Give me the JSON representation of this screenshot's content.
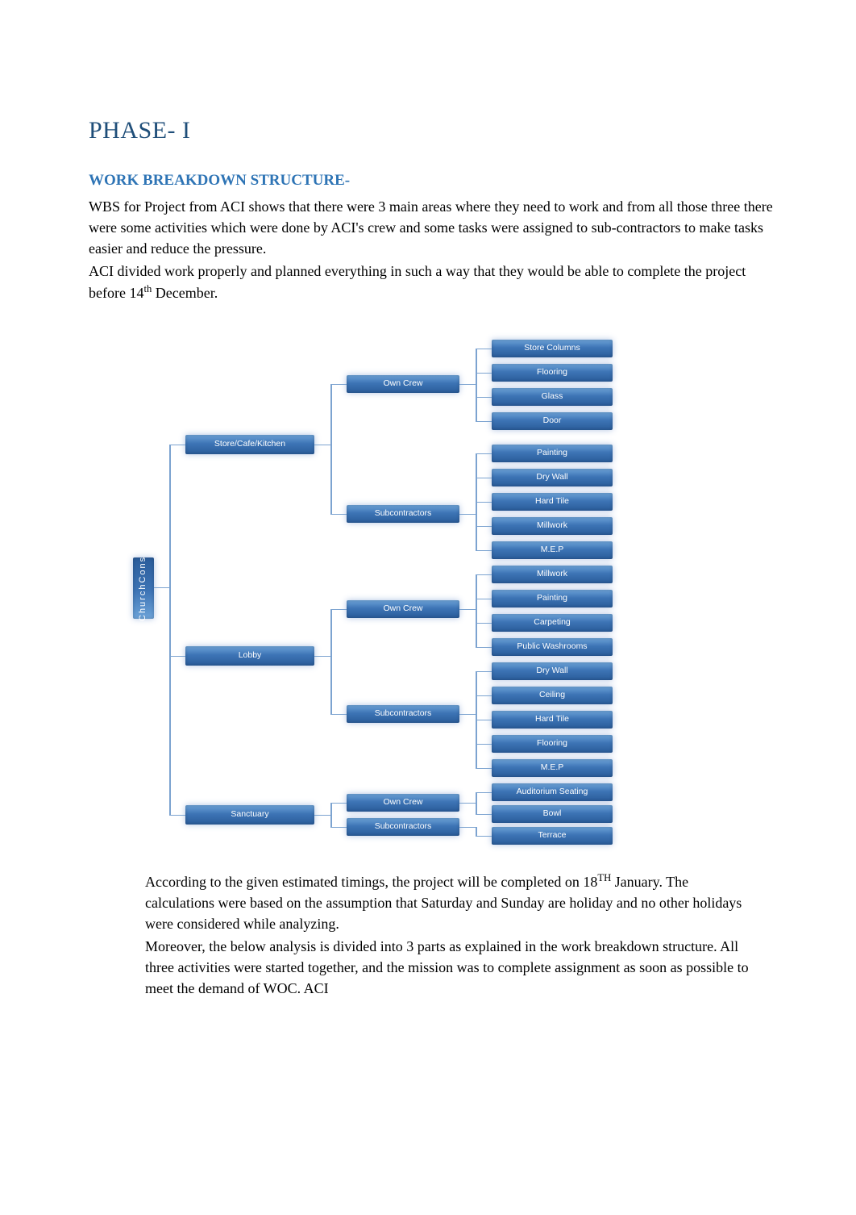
{
  "title": "PHASE- I",
  "subtitle": "WORK BREAKDOWN STRUCTURE-",
  "intro": {
    "p1": "WBS for Project from ACI shows that there were 3 main areas where they need to work and from all those three there were some activities which were done by ACI's crew and some tasks were assigned to sub-contractors to make tasks easier and reduce the pressure.",
    "p2a": "ACI divided work properly and planned everything in such a way that they would be able to complete the project before 14",
    "p2sup": "th",
    "p2b": " December."
  },
  "chart_data": {
    "type": "tree",
    "root": "ChurchCons",
    "children": [
      {
        "name": "Store/Cafe/Kitchen",
        "children": [
          {
            "name": "Own Crew",
            "children": [
              "Store Columns",
              "Flooring",
              "Glass",
              "Door"
            ]
          },
          {
            "name": "Subcontractors",
            "children": [
              "Painting",
              "Dry Wall",
              "Hard Tile",
              "Millwork",
              "M.E.P"
            ]
          }
        ]
      },
      {
        "name": "Lobby",
        "children": [
          {
            "name": "Own Crew",
            "children": [
              "Millwork",
              "Painting",
              "Carpeting",
              "Public Washrooms"
            ]
          },
          {
            "name": "Subcontractors",
            "children": [
              "Dry Wall",
              "Ceiling",
              "Hard Tile",
              "Flooring",
              "M.E.P"
            ]
          }
        ]
      },
      {
        "name": "Sanctuary",
        "children": [
          {
            "name": "Own Crew",
            "children": [
              "Auditorium Seating",
              "Bowl"
            ]
          },
          {
            "name": "Subcontractors",
            "children": [
              "Terrace"
            ]
          }
        ]
      }
    ]
  },
  "nodes": {
    "root": "ChurchCons",
    "store": "Store/Cafe/Kitchen",
    "lobby": "Lobby",
    "sanctuary": "Sanctuary",
    "own_crew": "Own Crew",
    "subcontractors": "Subcontractors",
    "store_columns": "Store Columns",
    "flooring": "Flooring",
    "glass": "Glass",
    "door": "Door",
    "painting": "Painting",
    "dry_wall": "Dry Wall",
    "hard_tile": "Hard Tile",
    "millwork": "Millwork",
    "mep": "M.E.P",
    "carpeting": "Carpeting",
    "public_washrooms": "Public Washrooms",
    "ceiling": "Ceiling",
    "auditorium_seating": "Auditorium Seating",
    "bowl": "Bowl",
    "terrace": "Terrace"
  },
  "after": {
    "p1a": "According to the given estimated timings, the project will be completed on 18",
    "p1sup": "TH",
    "p1b": " January. The calculations were based on the assumption that Saturday and Sunday are holiday and no other holidays were considered while analyzing.",
    "p2": "Moreover, the below analysis is divided into 3 parts as explained in the work breakdown structure. All three activities were started together, and the mission was to complete assignment as soon as possible to meet the demand of WOC. ACI"
  }
}
